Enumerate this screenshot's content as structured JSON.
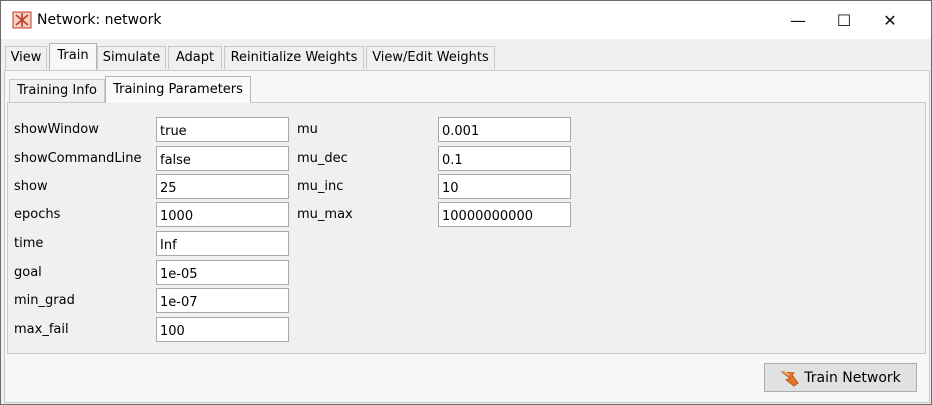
{
  "window": {
    "title": "Network: network",
    "controls": {
      "minimize": "—",
      "maximize": "☐",
      "close": "✕"
    }
  },
  "tabs": [
    "View",
    "Train",
    "Simulate",
    "Adapt",
    "Reinitialize Weights",
    "View/Edit Weights"
  ],
  "subtabs": [
    "Training Info",
    "Training Parameters"
  ],
  "params_left": [
    {
      "label": "showWindow",
      "value": "true"
    },
    {
      "label": "showCommandLine",
      "value": "false"
    },
    {
      "label": "show",
      "value": "25"
    },
    {
      "label": "epochs",
      "value": "1000"
    },
    {
      "label": "time",
      "value": "Inf"
    },
    {
      "label": "goal",
      "value": "1e-05"
    },
    {
      "label": "min_grad",
      "value": "1e-07"
    },
    {
      "label": "max_fail",
      "value": "100"
    }
  ],
  "params_right": [
    {
      "label": "mu",
      "value": "0.001"
    },
    {
      "label": "mu_dec",
      "value": "0.1"
    },
    {
      "label": "mu_inc",
      "value": "10"
    },
    {
      "label": "mu_max",
      "value": "10000000000"
    }
  ],
  "train_button": {
    "label": "Train Network",
    "icon": "train-icon"
  },
  "colors": {
    "app_icon": "#c0392b",
    "train_icon": "#e8732a"
  }
}
